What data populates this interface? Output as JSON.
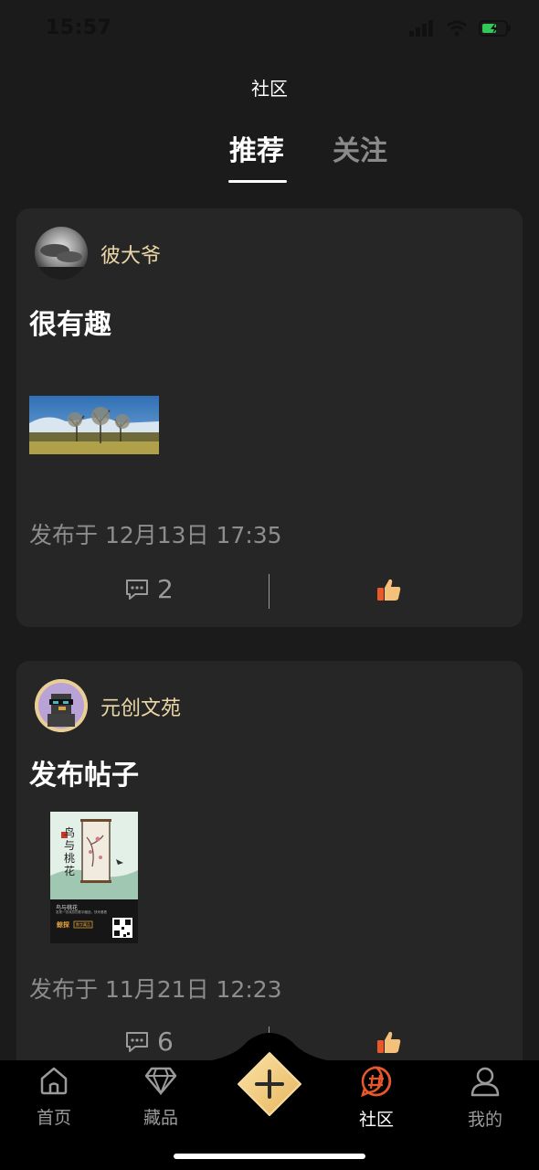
{
  "status_bar": {
    "time": "15:57"
  },
  "header": {
    "title": "社区"
  },
  "tabs": [
    {
      "label": "推荐",
      "active": true
    },
    {
      "label": "关注",
      "active": false
    }
  ],
  "posts": [
    {
      "author": "彼大爷",
      "text": "很有趣",
      "date": "发布于 12月13日 17:35",
      "comments": "2"
    },
    {
      "author": "元创文苑",
      "text": "发布帖子",
      "date": "发布于 11月21日 12:23",
      "comments": "6",
      "poster": {
        "title_vertical": "鸟与桃花",
        "caption": "鸟与桃花",
        "subcaption": "发现一张深层的数字藏品，快来看看",
        "brand": "鲸探",
        "badge": "数字藏品"
      }
    }
  ],
  "bottom_nav": {
    "items": [
      {
        "label": "首页",
        "icon": "home-icon"
      },
      {
        "label": "藏品",
        "icon": "diamond-icon"
      },
      {
        "label": "社区",
        "icon": "hash-icon",
        "active": true
      },
      {
        "label": "我的",
        "icon": "user-icon"
      }
    ],
    "add_icon": "plus-icon"
  },
  "colors": {
    "background": "#1b1b1b",
    "card": "#262626",
    "username": "#ecd7a6",
    "accent_orange": "#e8582a",
    "add_button": "#f2c979"
  }
}
